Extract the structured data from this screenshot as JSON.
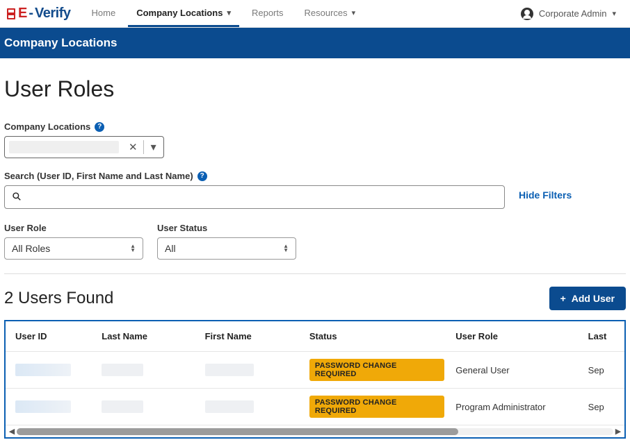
{
  "brand": {
    "e": "E",
    "dash": "-",
    "verify": "Verify"
  },
  "nav": {
    "home": "Home",
    "company_locations": "Company Locations",
    "reports": "Reports",
    "resources": "Resources"
  },
  "user_menu": {
    "label": "Corporate Admin"
  },
  "bluebar": {
    "title": "Company Locations"
  },
  "page": {
    "title": "User Roles"
  },
  "filters": {
    "company_locations": {
      "label": "Company Locations"
    },
    "search": {
      "label": "Search (User ID, First Name and Last Name)"
    },
    "hide_filters": "Hide Filters",
    "role": {
      "label": "User Role",
      "value": "All Roles"
    },
    "status": {
      "label": "User Status",
      "value": "All"
    }
  },
  "results": {
    "count_text": "2 Users Found",
    "add_user": "Add User"
  },
  "table": {
    "headers": {
      "user_id": "User ID",
      "last_name": "Last Name",
      "first_name": "First Name",
      "status": "Status",
      "user_role": "User Role",
      "last": "Last"
    },
    "rows": [
      {
        "status": "PASSWORD CHANGE REQUIRED",
        "role": "General User",
        "last": "Sep "
      },
      {
        "status": "PASSWORD CHANGE REQUIRED",
        "role": "Program Administrator",
        "last": "Sep "
      }
    ]
  }
}
